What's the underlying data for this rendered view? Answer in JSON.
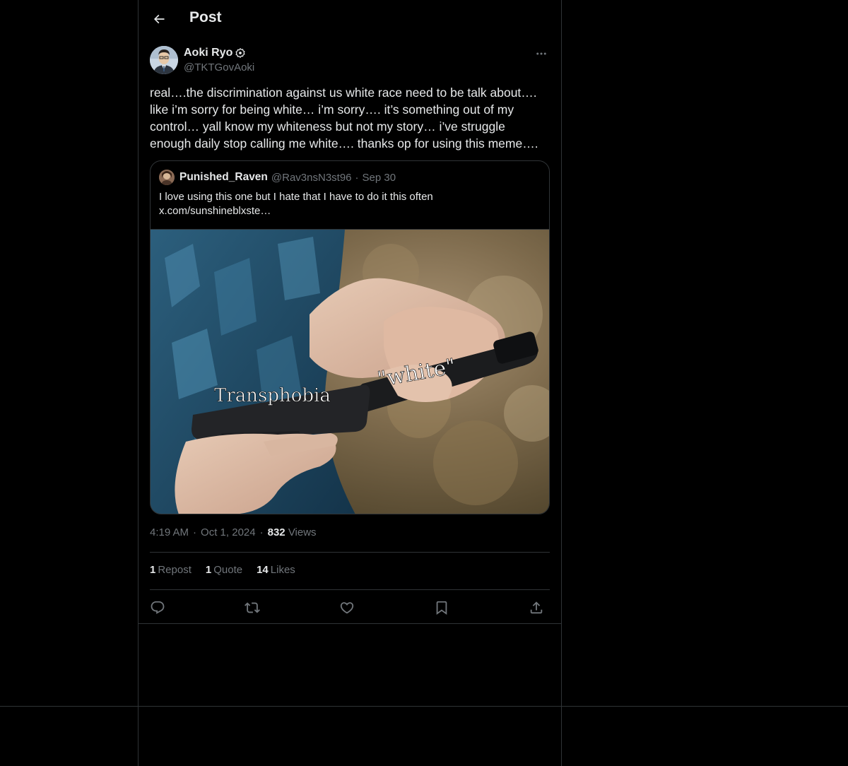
{
  "header": {
    "title": "Post"
  },
  "post": {
    "author_name": "Aoki Ryo",
    "author_handle": "@TKTGovAoki",
    "text": "real….the discrimination against us white race need to be talk about…. like i’m sorry for being white… i’m sorry…. it’s something out of my control… yall know my whiteness but not my story… i’ve struggle enough daily stop calling me white…. thanks op for using this meme….",
    "time": "4:19 AM",
    "date": "Oct 1, 2024",
    "views_count": "832",
    "views_label": "Views"
  },
  "quote": {
    "author_name": "Punished_Raven",
    "author_handle": "@Rav3nsN3st96",
    "date": "Sep 30",
    "text_line1": "I love using this one but I hate that I have to do it this often",
    "text_line2": "x.com/sunshineblxste…",
    "media": {
      "label_left": "Transphobia",
      "label_right": "\"white\""
    }
  },
  "stats": {
    "reposts_count": "1",
    "reposts_label": "Repost",
    "quotes_count": "1",
    "quotes_label": "Quote",
    "likes_count": "14",
    "likes_label": "Likes"
  },
  "actions": {
    "icons": [
      "reply-icon",
      "repost-icon",
      "like-icon",
      "bookmark-icon",
      "share-icon"
    ]
  },
  "colors": {
    "background": "#000000",
    "text": "#e7e9ea",
    "muted": "#71767b",
    "border": "#2f3336"
  }
}
